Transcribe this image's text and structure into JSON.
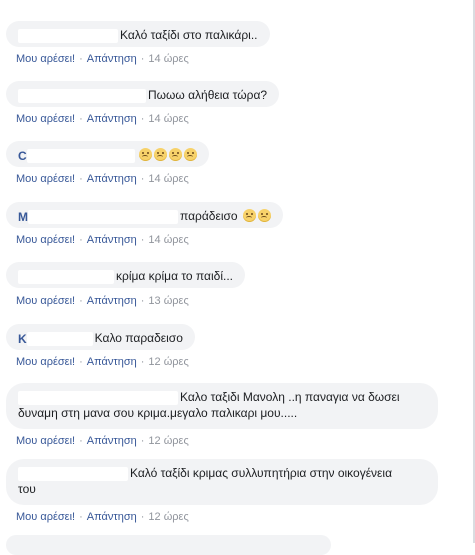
{
  "actions": {
    "like": "Μου αρέσει!",
    "reply": "Απάντηση",
    "separator": "·"
  },
  "comments": [
    {
      "text": "Καλό ταξίδι στο παλικάρι..",
      "time": "14 ώρες"
    },
    {
      "text": "Πωωω αλήθεια τώρα?",
      "time": "14 ώρες"
    },
    {
      "text": "",
      "author_initial": "C",
      "emoji": [
        "disappointed-face-icon",
        "disappointed-face-icon",
        "disappointed-face-icon",
        "disappointed-face-icon"
      ],
      "time": "14 ώρες"
    },
    {
      "text": "παράδεισο",
      "author_initial": "M",
      "emoji": [
        "disappointed-face-icon",
        "disappointed-face-icon"
      ],
      "time": "14 ώρες"
    },
    {
      "text": "κρίμα κρίμα το παιδί...",
      "time": "13 ώρες"
    },
    {
      "text": "Καλο παραδεισο",
      "author_initial": "K",
      "time": "12 ώρες"
    },
    {
      "text_line1": "Καλο ταξιδι Μανολη ..η παναγια να δωσει",
      "text_line2": "δυναμη στη μανα σου κριμα.μεγαλο παλικαρι μου.....",
      "time": "12 ώρες"
    },
    {
      "text_line1": "Καλό ταξίδι κριμας συλλυπητήρια στην οικογένεια",
      "text_line2": "του",
      "time": "12 ώρες"
    }
  ]
}
